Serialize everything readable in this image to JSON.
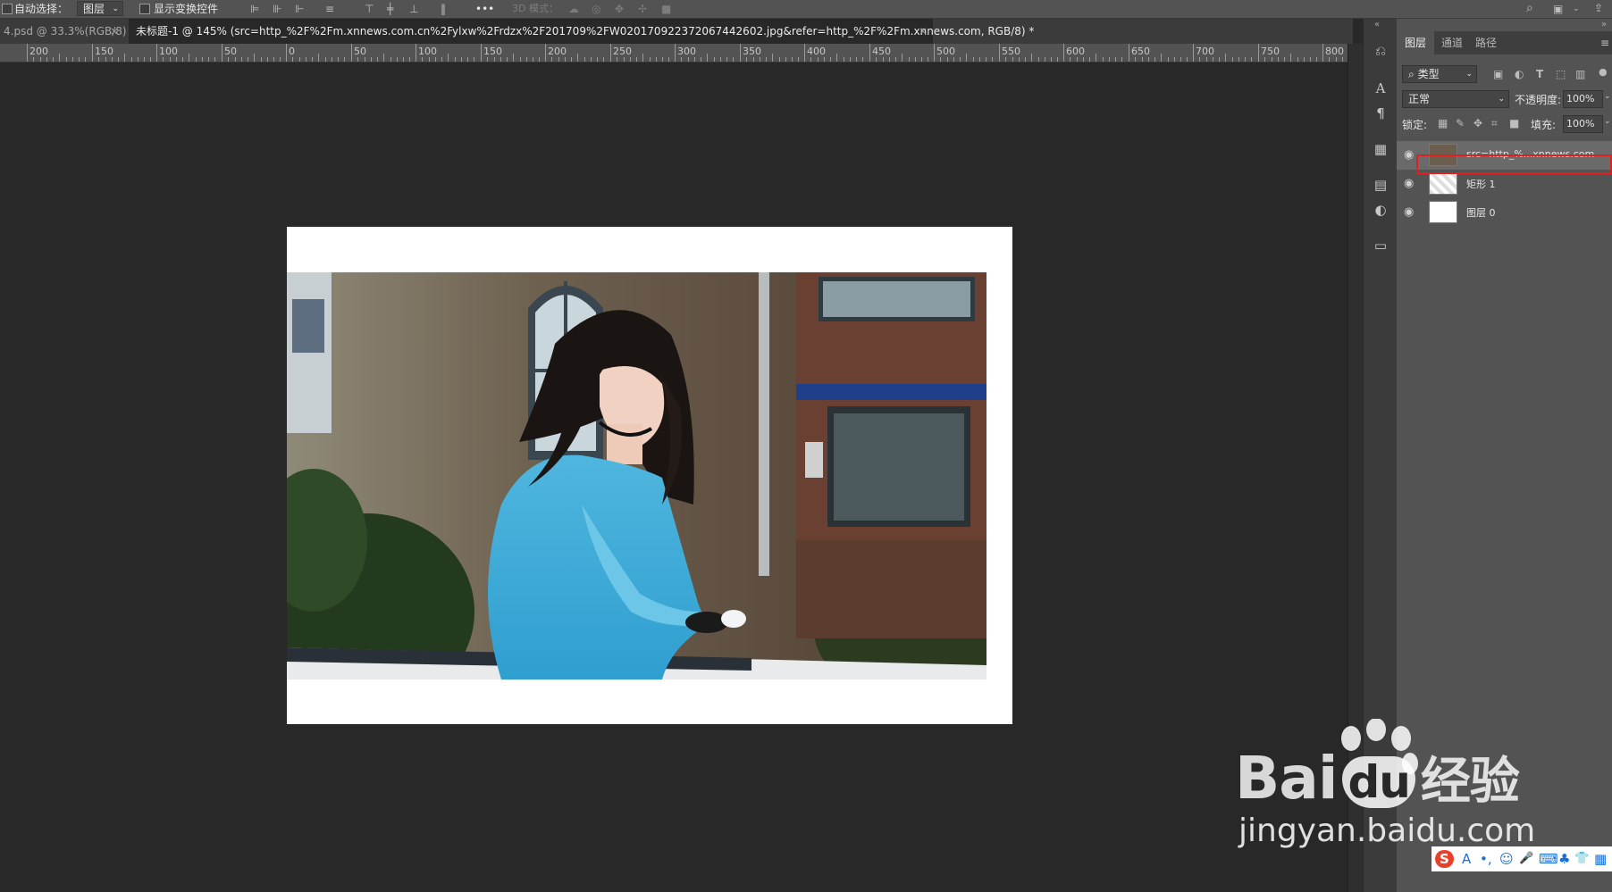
{
  "options_bar": {
    "auto_select_label": "自动选择：",
    "auto_select_value": "图层",
    "show_transform_label": "显示变换控件",
    "more_label": "•••",
    "mode_3d_label": "3D 模式："
  },
  "tabs": [
    {
      "label": "4.psd @ 33.3%(RGB/8)",
      "active": false
    },
    {
      "label": "未标题-1 @ 145% (src=http_%2F%2Fm.xnnews.com.cn%2Fylxw%2Frdzx%2F201709%2FW020170922372067442602.jpg&refer=http_%2F%2Fm.xnnews.com, RGB/8) *",
      "active": true
    }
  ],
  "ruler": {
    "labels": [
      "200",
      "150",
      "100",
      "50",
      "0",
      "50",
      "100",
      "150",
      "200",
      "250",
      "300",
      "350",
      "400",
      "450",
      "500",
      "550",
      "600",
      "650",
      "700",
      "750",
      "800"
    ]
  },
  "layers_panel": {
    "tabs": [
      "图层",
      "通道",
      "路径"
    ],
    "filter_label": "类型",
    "blend_mode": "正常",
    "opacity_label": "不透明度:",
    "opacity_value": "100%",
    "lock_label": "锁定:",
    "fill_label": "填充:",
    "fill_value": "100%",
    "layers": [
      {
        "name": "src=http_%...xnnews.com",
        "visible": true
      },
      {
        "name": "矩形 1",
        "visible": true
      },
      {
        "name": "图层 0",
        "visible": true
      }
    ]
  },
  "watermark": {
    "brand": "Bai",
    "brand_du": "du",
    "brand_cn": "经验",
    "url": "jingyan.baidu.com"
  },
  "ime_bar": {
    "logo": "S",
    "items": [
      "A",
      "•,",
      "☺",
      "🎤",
      "⌨",
      "♣",
      "👕",
      "▦"
    ]
  },
  "colors": {
    "accent_highlight": "#e02020",
    "canvas_bg": "#282828",
    "panel_bg": "#535353"
  }
}
